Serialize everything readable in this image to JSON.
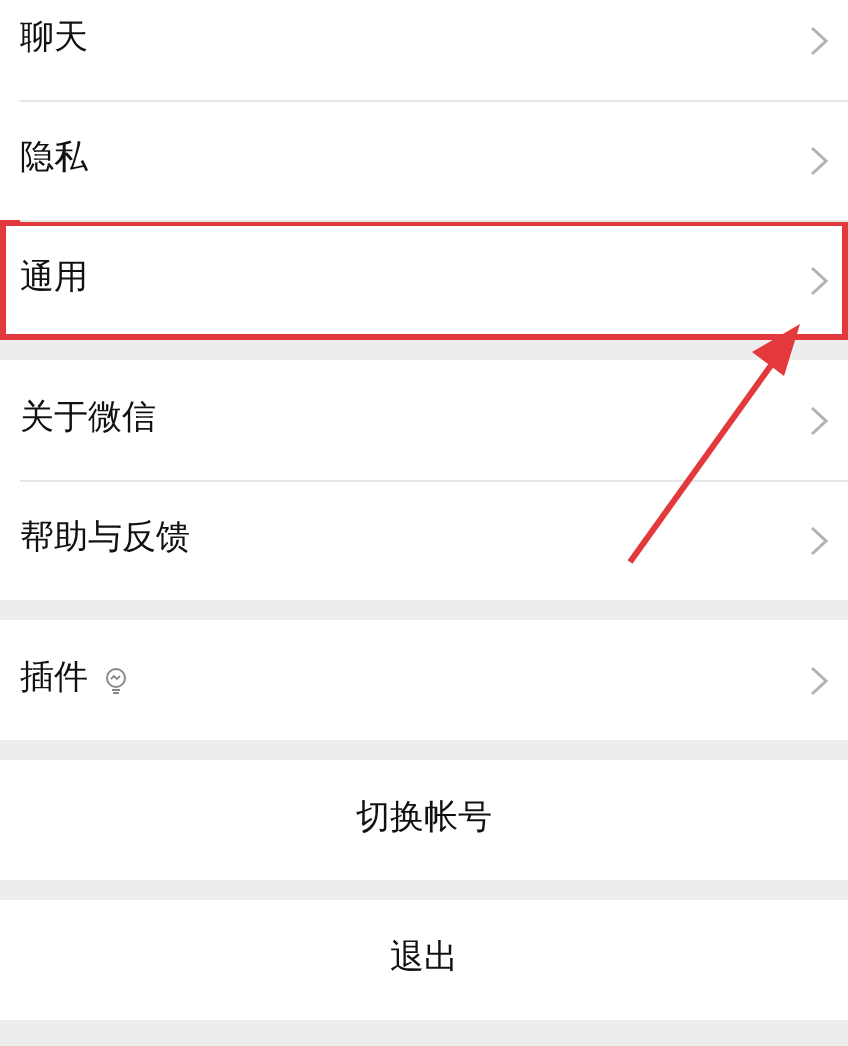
{
  "groups": [
    {
      "items": [
        {
          "kind": "nav",
          "label": "聊天",
          "highlighted": false
        },
        {
          "kind": "nav",
          "label": "隐私",
          "highlighted": false
        },
        {
          "kind": "nav",
          "label": "通用",
          "highlighted": true
        }
      ]
    },
    {
      "items": [
        {
          "kind": "nav",
          "label": "关于微信",
          "highlighted": false
        },
        {
          "kind": "nav",
          "label": "帮助与反馈",
          "highlighted": false
        }
      ]
    },
    {
      "items": [
        {
          "kind": "nav",
          "label": "插件",
          "highlighted": false,
          "badge_icon": true
        }
      ]
    },
    {
      "items": [
        {
          "kind": "action",
          "label": "切换帐号",
          "highlighted": false
        }
      ]
    },
    {
      "items": [
        {
          "kind": "action",
          "label": "退出",
          "highlighted": false
        }
      ]
    }
  ]
}
